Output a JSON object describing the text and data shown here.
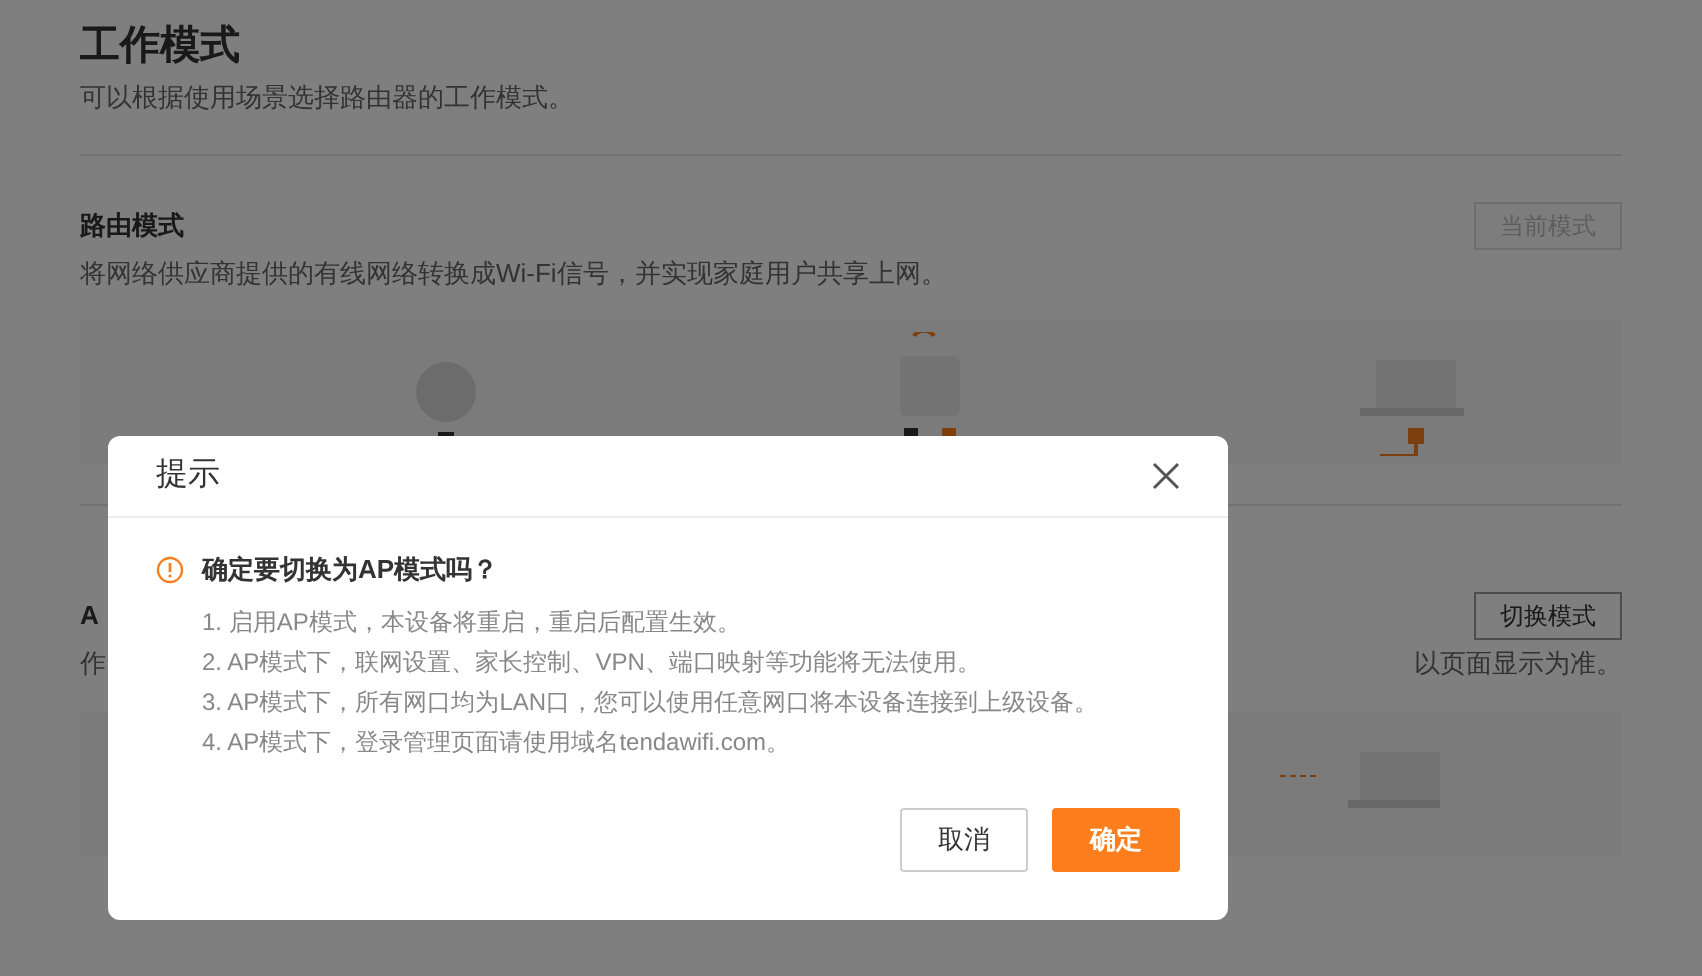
{
  "page": {
    "title": "工作模式",
    "subtitle": "可以根据使用场景选择路由器的工作模式。"
  },
  "modes": [
    {
      "title": "路由模式",
      "description": "将网络供应商提供的有线网络转换成Wi-Fi信号，并实现家庭用户共享上网。",
      "button": "当前模式",
      "current": true
    },
    {
      "title": "A",
      "description": "作",
      "description_tail": "以页面显示为准。",
      "button": "切换模式",
      "current": false
    }
  ],
  "dialog": {
    "title": "提示",
    "question": "确定要切换为AP模式吗？",
    "items": [
      "1. 启用AP模式，本设备将重启，重启后配置生效。",
      "2. AP模式下，联网设置、家长控制、VPN、端口映射等功能将无法使用。",
      "3. AP模式下，所有网口均为LAN口，您可以使用任意网口将本设备连接到上级设备。",
      "4. AP模式下，登录管理页面请使用域名tendawifi.com。"
    ],
    "buttons": [
      {
        "label": "取消",
        "kind": "cancel"
      },
      {
        "label": "确定",
        "kind": "primary"
      }
    ]
  }
}
